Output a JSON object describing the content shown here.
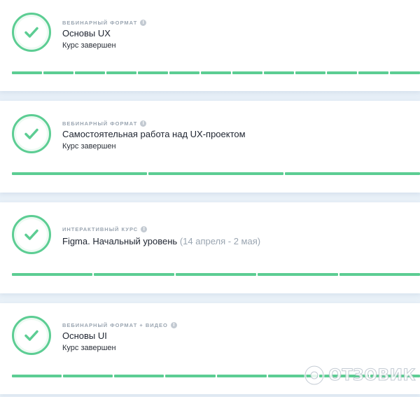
{
  "colors": {
    "accent": "#5ccd93",
    "muted": "#9aa5b1"
  },
  "cards": [
    {
      "format": "Вебинарный формат",
      "title": "Основы UX",
      "dates": "",
      "status": "Курс завершен",
      "progress_segments": 13,
      "progress_complete": 1.0
    },
    {
      "format": "Вебинарный формат",
      "title": "Самостоятельная работа над UX-проектом",
      "dates": "",
      "status": "Курс завершен",
      "progress_segments": 3,
      "progress_complete": 1.0
    },
    {
      "format": "Интерактивный курс",
      "title": "Figma. Начальный уровень",
      "dates": "(14 апреля - 2 мая)",
      "status": "",
      "progress_segments": 5,
      "progress_complete": 1.0
    },
    {
      "format": "Вебинарный формат + видео",
      "title": "Основы UI",
      "dates": "",
      "status": "Курс завершен",
      "progress_segments": 8,
      "progress_complete": 1.0
    }
  ],
  "icons": {
    "check": "check-icon",
    "info": "info-icon"
  },
  "info_glyph": "i",
  "watermark": "ОТЗОВИК"
}
